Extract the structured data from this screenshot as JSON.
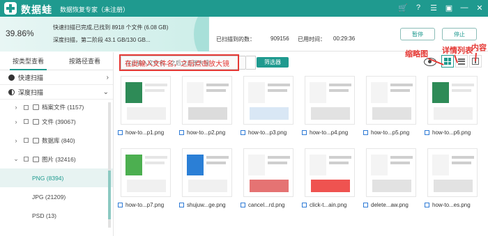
{
  "titlebar": {
    "brand": "数据蛙",
    "subtitle": "数据恢复专家（未注册）",
    "icons": [
      "cart-icon",
      "help-icon",
      "chat-icon",
      "save-icon",
      "minimize-icon",
      "close-icon"
    ]
  },
  "status": {
    "progress_percent": "39.86%",
    "progress_fraction": 0.3986,
    "quick_scan": "快速扫描已完成,已找到 8918 个文件 (6.08 GB)",
    "deep_scan": "深度扫描，第二阶段 43.1 GB/130 GB...",
    "found_label": "已扫描到的数：",
    "found_value": "909156",
    "time_label": "已用时间：",
    "time_value": "00:29:36",
    "pause_label": "暂停",
    "stop_label": "停止"
  },
  "sidebar": {
    "tabs": [
      "按类型查看",
      "按路径查看"
    ],
    "quick_scan": "快速扫描",
    "deep_scan": "深度扫描",
    "tree": [
      {
        "label": "档案文件 (1157)",
        "expanded": false
      },
      {
        "label": "文件 (39067)",
        "expanded": false
      },
      {
        "label": "数据库 (840)",
        "expanded": false
      },
      {
        "label": "图片 (32416)",
        "expanded": true
      }
    ],
    "subitems": [
      "PNG (8394)",
      "JPG (21209)",
      "PSD (13)"
    ]
  },
  "toolbar": {
    "search_placeholder": "在此输入文件名，之后点击放大镜",
    "filter_label": "筛选器",
    "annotations": {
      "thumbnail": "缩略图",
      "detail_list": "详情列表",
      "content": "内容"
    }
  },
  "files": [
    "how-to...p1.png",
    "how-to...p2.png",
    "how-to...p3.png",
    "how-to...p4.png",
    "how-to...p5.png",
    "how-to...p6.png",
    "how-to...p7.png",
    "shujuw...ge.png",
    "cancel...rd.png",
    "click-t...ain.png",
    "delete...aw.png",
    "how-to...es.png"
  ],
  "colors": {
    "accent": "#1f9a8f",
    "annotation": "#e53935"
  }
}
